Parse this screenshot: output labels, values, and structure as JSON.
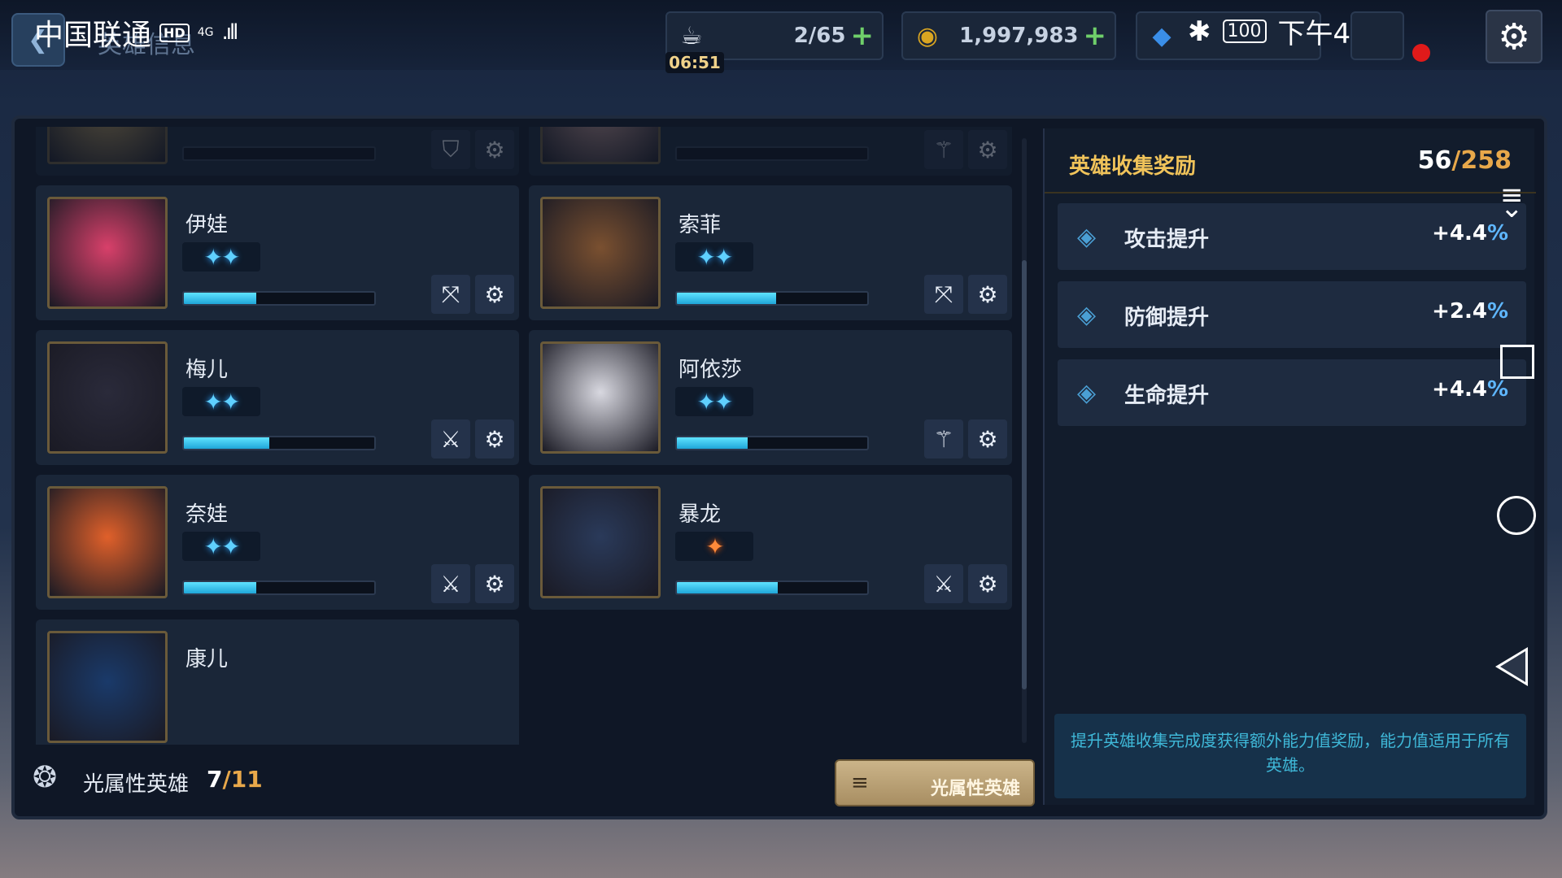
{
  "statusbar": {
    "carrier": "中国联通",
    "hd": "HD",
    "network": "4G",
    "signal": ".ıll",
    "bluetooth": "✱",
    "battery": "100",
    "time": "下午4:28"
  },
  "header": {
    "page_title": "英雄信息",
    "stamina": {
      "value": "2/65",
      "plus": "+",
      "timer": "06:51"
    },
    "gold": {
      "value": "1,997,983",
      "plus": "+"
    },
    "gems": {
      "value": ""
    }
  },
  "heroes": [
    {
      "name": "",
      "stars": "★★★",
      "star_style": "gold",
      "xp": 0,
      "role_icon": "shield-icon",
      "dim": true
    },
    {
      "name": "",
      "stars": "★★★",
      "star_style": "gold",
      "xp": 0,
      "role_icon": "staff-icon",
      "dim": true
    },
    {
      "name": "伊娃",
      "stars": "✦✦",
      "star_style": "blue",
      "xp": 0.38,
      "role_icon": "crossed-bow-icon"
    },
    {
      "name": "索菲",
      "stars": "✦✦",
      "star_style": "blue",
      "xp": 0.52,
      "role_icon": "crossed-bow-icon"
    },
    {
      "name": "梅儿",
      "stars": "✦✦",
      "star_style": "blue",
      "xp": 0.45,
      "role_icon": "crossed-swords-icon"
    },
    {
      "name": "阿依莎",
      "stars": "✦✦",
      "star_style": "blue",
      "xp": 0.37,
      "role_icon": "staff-icon"
    },
    {
      "name": "奈娃",
      "stars": "✦✦",
      "star_style": "blue",
      "xp": 0.38,
      "role_icon": "crossed-swords-icon"
    },
    {
      "name": "暴龙",
      "stars": "✦",
      "star_style": "orange",
      "xp": 0.53,
      "role_icon": "crossed-swords-icon"
    },
    {
      "name": "康儿",
      "stars": "",
      "star_style": "blue",
      "xp": 0,
      "role_icon": ""
    }
  ],
  "footer": {
    "label": "光属性英雄",
    "count_current": "7",
    "count_total": "/11",
    "filter_label": "光属性英雄",
    "filter_icon": "≡"
  },
  "rewards": {
    "title": "英雄收集奖励",
    "count_current": "56",
    "count_total": "/258",
    "items": [
      {
        "label": "攻击提升",
        "value": "+4.4",
        "unit": "%"
      },
      {
        "label": "防御提升",
        "value": "+2.4",
        "unit": "%"
      },
      {
        "label": "生命提升",
        "value": "+4.4",
        "unit": "%"
      }
    ],
    "note": "提升英雄收集完成度获得额外能力值奖励，能力值适用于所有英雄。"
  },
  "colors": {
    "accent_gold": "#e8a84a",
    "accent_blue": "#5fd0ff",
    "note_text": "#3fb8d8"
  }
}
